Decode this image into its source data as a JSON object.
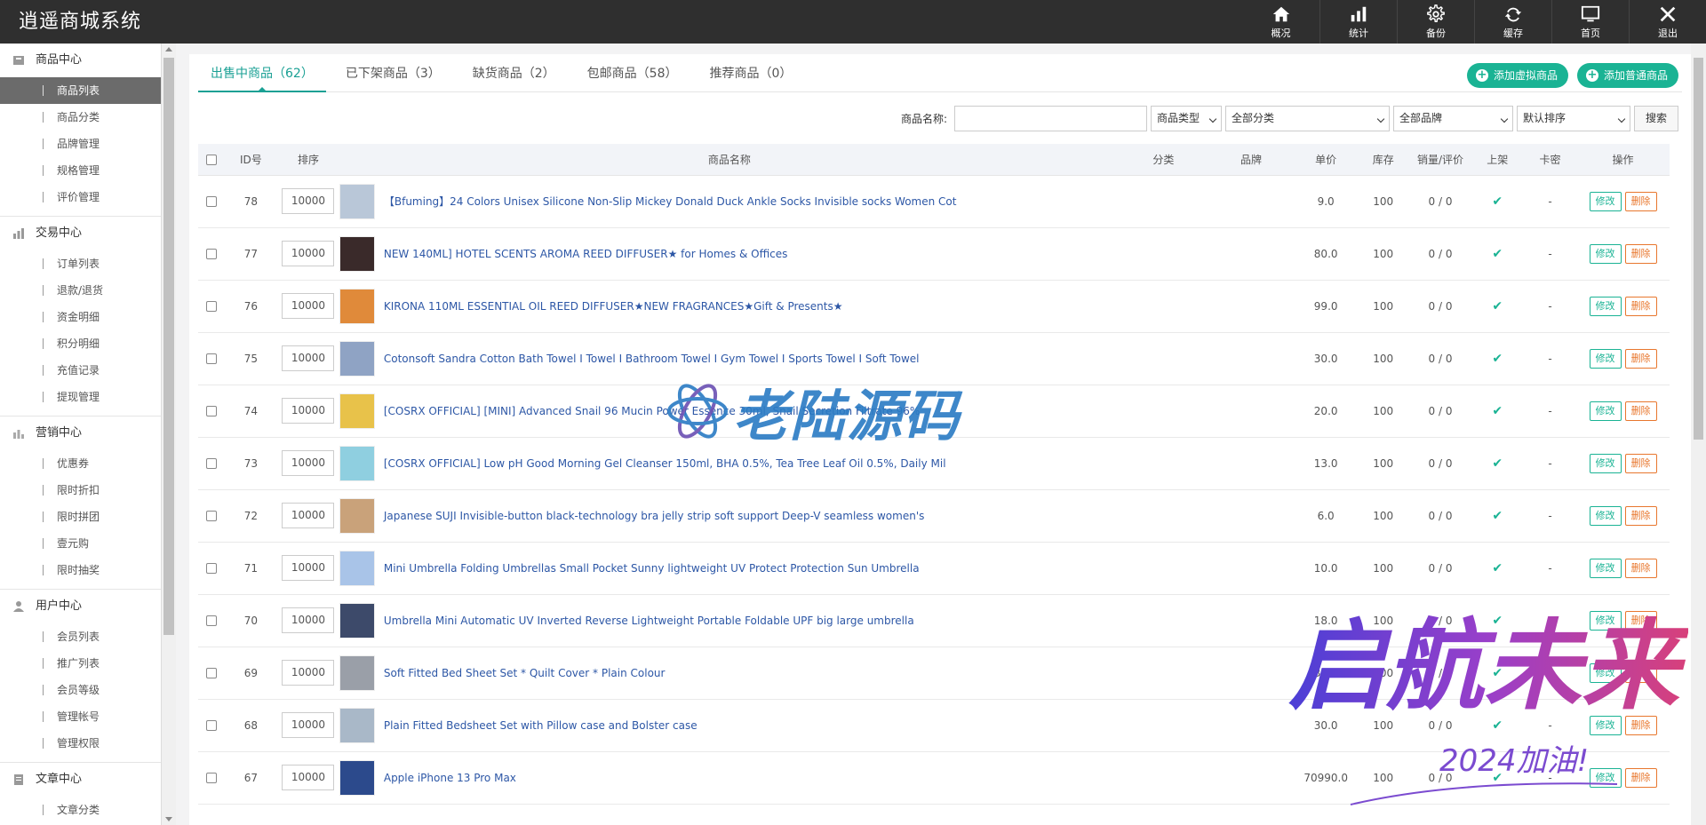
{
  "app": {
    "title": "逍遥商城系统"
  },
  "topnav": [
    {
      "label": "概况",
      "icon": "home-icon"
    },
    {
      "label": "统计",
      "icon": "bar-chart-icon"
    },
    {
      "label": "备份",
      "icon": "gear-icon"
    },
    {
      "label": "缓存",
      "icon": "refresh-icon"
    },
    {
      "label": "首页",
      "icon": "monitor-icon"
    },
    {
      "label": "退出",
      "icon": "close-icon"
    }
  ],
  "sidebar": {
    "groups": [
      {
        "title": "商品中心",
        "items": [
          "商品列表",
          "商品分类",
          "品牌管理",
          "规格管理",
          "评价管理"
        ]
      },
      {
        "title": "交易中心",
        "items": [
          "订单列表",
          "退款/退货",
          "资金明细",
          "积分明细",
          "充值记录",
          "提现管理"
        ]
      },
      {
        "title": "营销中心",
        "items": [
          "优惠券",
          "限时折扣",
          "限时拼团",
          "壹元购",
          "限时抽奖"
        ]
      },
      {
        "title": "用户中心",
        "items": [
          "会员列表",
          "推广列表",
          "会员等级",
          "管理帐号",
          "管理权限"
        ]
      },
      {
        "title": "文章中心",
        "items": [
          "文章分类"
        ]
      }
    ],
    "active_item": "商品列表"
  },
  "tabs": [
    {
      "label": "出售中商品（62）",
      "active": true
    },
    {
      "label": "已下架商品（3）",
      "active": false
    },
    {
      "label": "缺货商品（2）",
      "active": false
    },
    {
      "label": "包邮商品（58）",
      "active": false
    },
    {
      "label": "推荐商品（0）",
      "active": false
    }
  ],
  "buttons": {
    "add_virtual": "添加虚拟商品",
    "add_normal": "添加普通商品",
    "search": "搜索"
  },
  "filters": {
    "name_label": "商品名称:",
    "name_value": "",
    "type": "商品类型",
    "category": "全部分类",
    "brand": "全部品牌",
    "sort": "默认排序"
  },
  "table": {
    "headers": [
      "ID号",
      "排序",
      "商品名称",
      "分类",
      "品牌",
      "单价",
      "库存",
      "销量/评价",
      "上架",
      "卡密",
      "操作"
    ],
    "edit_label": "修改",
    "delete_label": "删除",
    "rows": [
      {
        "id": "78",
        "sort": "10000",
        "name": "【Bfuming】24 Colors Unisex Silicone Non-Slip Mickey Donald Duck Ankle Socks Invisible socks Women Cot",
        "price": "9.0",
        "stock": "100",
        "sales": "0 / 0",
        "card": "-",
        "img_color": "#b9c7d8"
      },
      {
        "id": "77",
        "sort": "10000",
        "name": "NEW 140ML] HOTEL SCENTS AROMA REED DIFFUSER★ for Homes & Offices",
        "price": "80.0",
        "stock": "100",
        "sales": "0 / 0",
        "card": "-",
        "img_color": "#3a2a2a"
      },
      {
        "id": "76",
        "sort": "10000",
        "name": "KIRONA 110ML ESSENTIAL OIL REED DIFFUSER★NEW FRAGRANCES★Gift & Presents★",
        "price": "99.0",
        "stock": "100",
        "sales": "0 / 0",
        "card": "-",
        "img_color": "#e08a3a"
      },
      {
        "id": "75",
        "sort": "10000",
        "name": "Cotonsoft Sandra Cotton Bath Towel I Towel I Bathroom Towel I Gym Towel I Sports Towel I Soft Towel",
        "price": "30.0",
        "stock": "100",
        "sales": "0 / 0",
        "card": "-",
        "img_color": "#8fa3c4"
      },
      {
        "id": "74",
        "sort": "10000",
        "name": "[COSRX OFFICIAL] [MINI] Advanced Snail 96 Mucin Power Essence 30ml, Snail Secretion Filtrate 96%",
        "price": "20.0",
        "stock": "100",
        "sales": "0 / 0",
        "card": "-",
        "img_color": "#e8c24a"
      },
      {
        "id": "73",
        "sort": "10000",
        "name": "[COSRX OFFICIAL] Low pH Good Morning Gel Cleanser 150ml, BHA 0.5%, Tea Tree Leaf Oil 0.5%, Daily Mil",
        "price": "13.0",
        "stock": "100",
        "sales": "0 / 0",
        "card": "-",
        "img_color": "#8fcfe0"
      },
      {
        "id": "72",
        "sort": "10000",
        "name": "Japanese SUJI Invisible-button black-technology bra jelly strip soft support Deep-V seamless women's",
        "price": "6.0",
        "stock": "100",
        "sales": "0 / 0",
        "card": "-",
        "img_color": "#c9a27a"
      },
      {
        "id": "71",
        "sort": "10000",
        "name": "Mini Umbrella Folding Umbrellas Small Pocket Sunny lightweight UV Protect Protection Sun Umbrella",
        "price": "10.0",
        "stock": "100",
        "sales": "0 / 0",
        "card": "-",
        "img_color": "#a9c4e8"
      },
      {
        "id": "70",
        "sort": "10000",
        "name": "Umbrella Mini Automatic UV Inverted Reverse Lightweight Portable Foldable UPF big large umbrella",
        "price": "18.0",
        "stock": "100",
        "sales": "0 / 0",
        "card": "-",
        "img_color": "#3d4a6a"
      },
      {
        "id": "69",
        "sort": "10000",
        "name": "Soft Fitted Bed Sheet Set * Quilt Cover * Plain Colour",
        "price": "30.0",
        "stock": "100",
        "sales": "0 / 0",
        "card": "-",
        "img_color": "#9a9fa8"
      },
      {
        "id": "68",
        "sort": "10000",
        "name": "Plain Fitted Bedsheet Set with Pillow case and Bolster case",
        "price": "30.0",
        "stock": "100",
        "sales": "0 / 0",
        "card": "-",
        "img_color": "#a9b8c8"
      },
      {
        "id": "67",
        "sort": "10000",
        "name": "Apple iPhone 13 Pro Max",
        "price": "70990.0",
        "stock": "100",
        "sales": "0 / 0",
        "card": "-",
        "img_color": "#2c4a8c"
      }
    ]
  },
  "watermarks": {
    "center": "老陆源码",
    "corner_main": "启航未来",
    "corner_sub": "2024加油!"
  }
}
